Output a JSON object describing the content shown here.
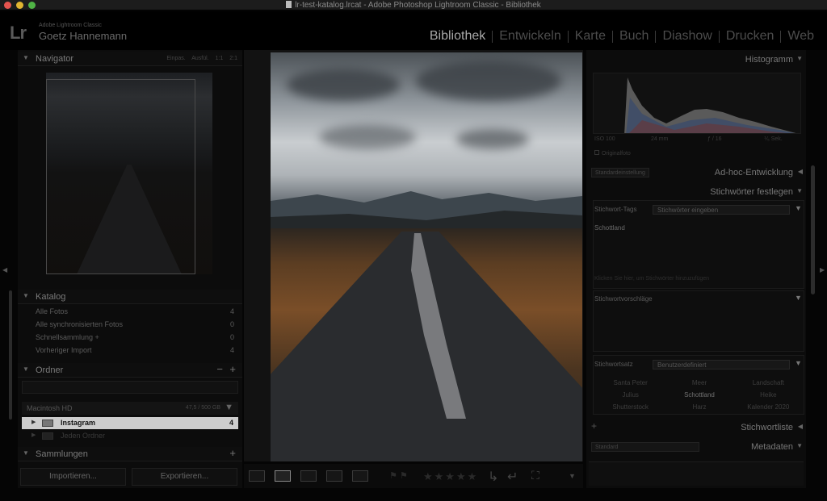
{
  "window": {
    "title": "lr-test-katalog.lrcat - Adobe Photoshop Lightroom Classic - Bibliothek"
  },
  "header": {
    "logo": "Lr",
    "product": "Adobe Lightroom Classic",
    "user": "Goetz Hannemann",
    "modules": [
      "Bibliothek",
      "Entwickeln",
      "Karte",
      "Buch",
      "Diashow",
      "Drucken",
      "Web"
    ],
    "active_module": "Bibliothek"
  },
  "left": {
    "navigator": {
      "title": "Navigator",
      "options": "Einpas.  Ausfül.  1:1  2:1"
    },
    "catalog": {
      "title": "Katalog",
      "items": [
        {
          "label": "Alle Fotos",
          "count": "4"
        },
        {
          "label": "Alle synchronisierten Fotos",
          "count": "0"
        },
        {
          "label": "Schnellsammlung +",
          "count": "0"
        },
        {
          "label": "Vorheriger Import",
          "count": "4"
        }
      ]
    },
    "folders": {
      "title": "Ordner",
      "minus": "−",
      "plus": "+",
      "drive": {
        "name": "Macintosh HD",
        "capacity": "47,5 / 500 GB"
      },
      "items": [
        {
          "name": "Instagram",
          "count": "4"
        },
        {
          "name": "Jeden Ordner",
          "count": ""
        }
      ]
    },
    "collections": {
      "title": "Sammlungen",
      "plus": "+"
    },
    "buttons": {
      "import": "Importieren...",
      "export": "Exportieren..."
    }
  },
  "toolbar": {
    "stars": "★★★★★"
  },
  "right": {
    "histogram": {
      "title": "Histogramm",
      "iso": "ISO 100",
      "focal": "24 mm",
      "aperture": "ƒ / 16",
      "shutter": "⅟₅ Sek.",
      "original": "Originalfoto"
    },
    "quick_develop": {
      "title": "Ad-hoc-Entwicklung",
      "preset": "Standardeinstellung"
    },
    "keywording": {
      "title": "Stichwörter festlegen",
      "tags_label": "Stichwort-Tags",
      "tags_value": "Stichwörter eingeben",
      "content": "Schottland",
      "hint": "Klicken Sie hier, um Stichwörter hinzuzufügen",
      "suggestions_title": "Stichwortvorschläge",
      "set_label": "Stichwortsatz",
      "set_value": "Benutzerdefiniert",
      "set_items": [
        "Santa Peter",
        "Meer",
        "Landschaft",
        "Julius",
        "Schottland",
        "Heike",
        "Shutterstock",
        "Harz",
        "Kalender 2020"
      ]
    },
    "keyword_list": {
      "title": "Stichwortliste",
      "plus": "+"
    },
    "metadata": {
      "title": "Metadaten",
      "preset": "Standard"
    }
  }
}
